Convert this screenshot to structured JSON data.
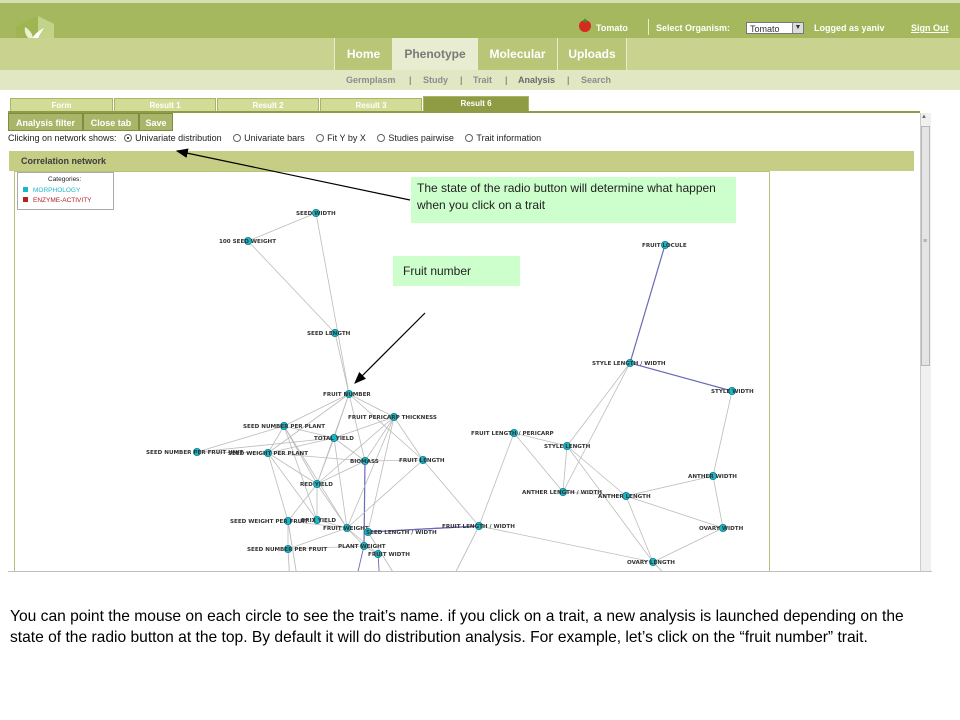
{
  "header": {
    "tomato_label": "Tomato",
    "select_organism_label": "Select Organism:",
    "organism_value": "Tomato",
    "logged_in_text": "Logged as yaniv",
    "sign_out_label": "Sign Out"
  },
  "nav": {
    "tabs": [
      "Home",
      "Phenotype",
      "Molecular",
      "Uploads"
    ],
    "active_tab": "Phenotype",
    "subnav": [
      "Germplasm",
      "Study",
      "Trait",
      "Analysis",
      "Search"
    ],
    "active_subnav": "Analysis"
  },
  "result_tabs": [
    "Form",
    "Result 1",
    "Result 2",
    "Result 3",
    "Result 6"
  ],
  "active_result_tab": "Result 6",
  "toolbar": [
    "Analysis filter",
    "Close tab",
    "Save"
  ],
  "click_options": {
    "label": "Clicking on network shows:",
    "options": [
      "Univariate distribution",
      "Univariate bars",
      "Fit Y by X",
      "Studies pairwise",
      "Trait information"
    ],
    "selected": "Univariate distribution"
  },
  "panel_title": "Correlation network",
  "legend": {
    "title": "Categories:",
    "items": [
      {
        "label": "MORPHOLOGY",
        "color": "#19b8c8"
      },
      {
        "label": "ENZYME-ACTIVITY",
        "color": "#b22222"
      }
    ]
  },
  "network": {
    "node_color": "#19b8c8",
    "nodes": [
      {
        "id": "seed_width",
        "label": "SEED WIDTH"
      },
      {
        "id": "seed_weight_100",
        "label": "100 SEED WEIGHT"
      },
      {
        "id": "seed_length",
        "label": "SEED LENGTH"
      },
      {
        "id": "fruit_number",
        "label": "FRUIT NUMBER"
      },
      {
        "id": "pericarp_thickness",
        "label": "FRUIT PERICARP THICKNESS"
      },
      {
        "id": "seed_number_plant",
        "label": "SEED NUMBER PER PLANT"
      },
      {
        "id": "total_yield",
        "label": "TOTAL YIELD"
      },
      {
        "id": "seed_number_fruit_unit",
        "label": "SEED NUMBER PER FRUIT UNIT"
      },
      {
        "id": "seed_weight_plant",
        "label": "SEED WEIGHT PER PLANT"
      },
      {
        "id": "biomass",
        "label": "BIOMASS"
      },
      {
        "id": "fruit_length",
        "label": "FRUIT LENGTH"
      },
      {
        "id": "red_yield",
        "label": "RED YIELD"
      },
      {
        "id": "seed_weight_fruit",
        "label": "SEED WEIGHT PER FRUIT"
      },
      {
        "id": "brix_yield",
        "label": "BRIX YIELD"
      },
      {
        "id": "fruit_weight",
        "label": "FRUIT WEIGHT"
      },
      {
        "id": "seed_length_width",
        "label": "SEED LENGTH / WIDTH"
      },
      {
        "id": "plant_weight",
        "label": "PLANT WEIGHT"
      },
      {
        "id": "fruit_width",
        "label": "FRUIT WIDTH"
      },
      {
        "id": "seed_number_fruit",
        "label": "SEED NUMBER PER FRUIT"
      },
      {
        "id": "fruit_length_width",
        "label": "FRUIT LENGTH / WIDTH"
      },
      {
        "id": "fruit_length_pericarp",
        "label": "FRUIT LENGTH / PERICARP"
      },
      {
        "id": "style_length",
        "label": "STYLE LENGTH"
      },
      {
        "id": "anther_length_width",
        "label": "ANTHER LENGTH / WIDTH"
      },
      {
        "id": "anther_length",
        "label": "ANTHER LENGTH"
      },
      {
        "id": "anther_width",
        "label": "ANTHER WIDTH"
      },
      {
        "id": "ovary_width",
        "label": "OVARY WIDTH"
      },
      {
        "id": "ovary_length",
        "label": "OVARY LENGTH"
      },
      {
        "id": "style_width",
        "label": "STYLE WIDTH"
      },
      {
        "id": "style_length_width",
        "label": "STYLE LENGTH / WIDTH"
      },
      {
        "id": "fruit_locule",
        "label": "FRUIT LOCULE"
      }
    ]
  },
  "callouts": {
    "radio_note": "The state of the radio button will determine what happen when you click on a trait",
    "fruit_number_note": "Fruit number"
  },
  "caption": "You can point the mouse on each circle to see the trait’s name. if you click on a trait, a new analysis is launched depending on the state of the radio button at the top. By default it will do distribution analysis. For example, let’s click on the “fruit number” trait."
}
